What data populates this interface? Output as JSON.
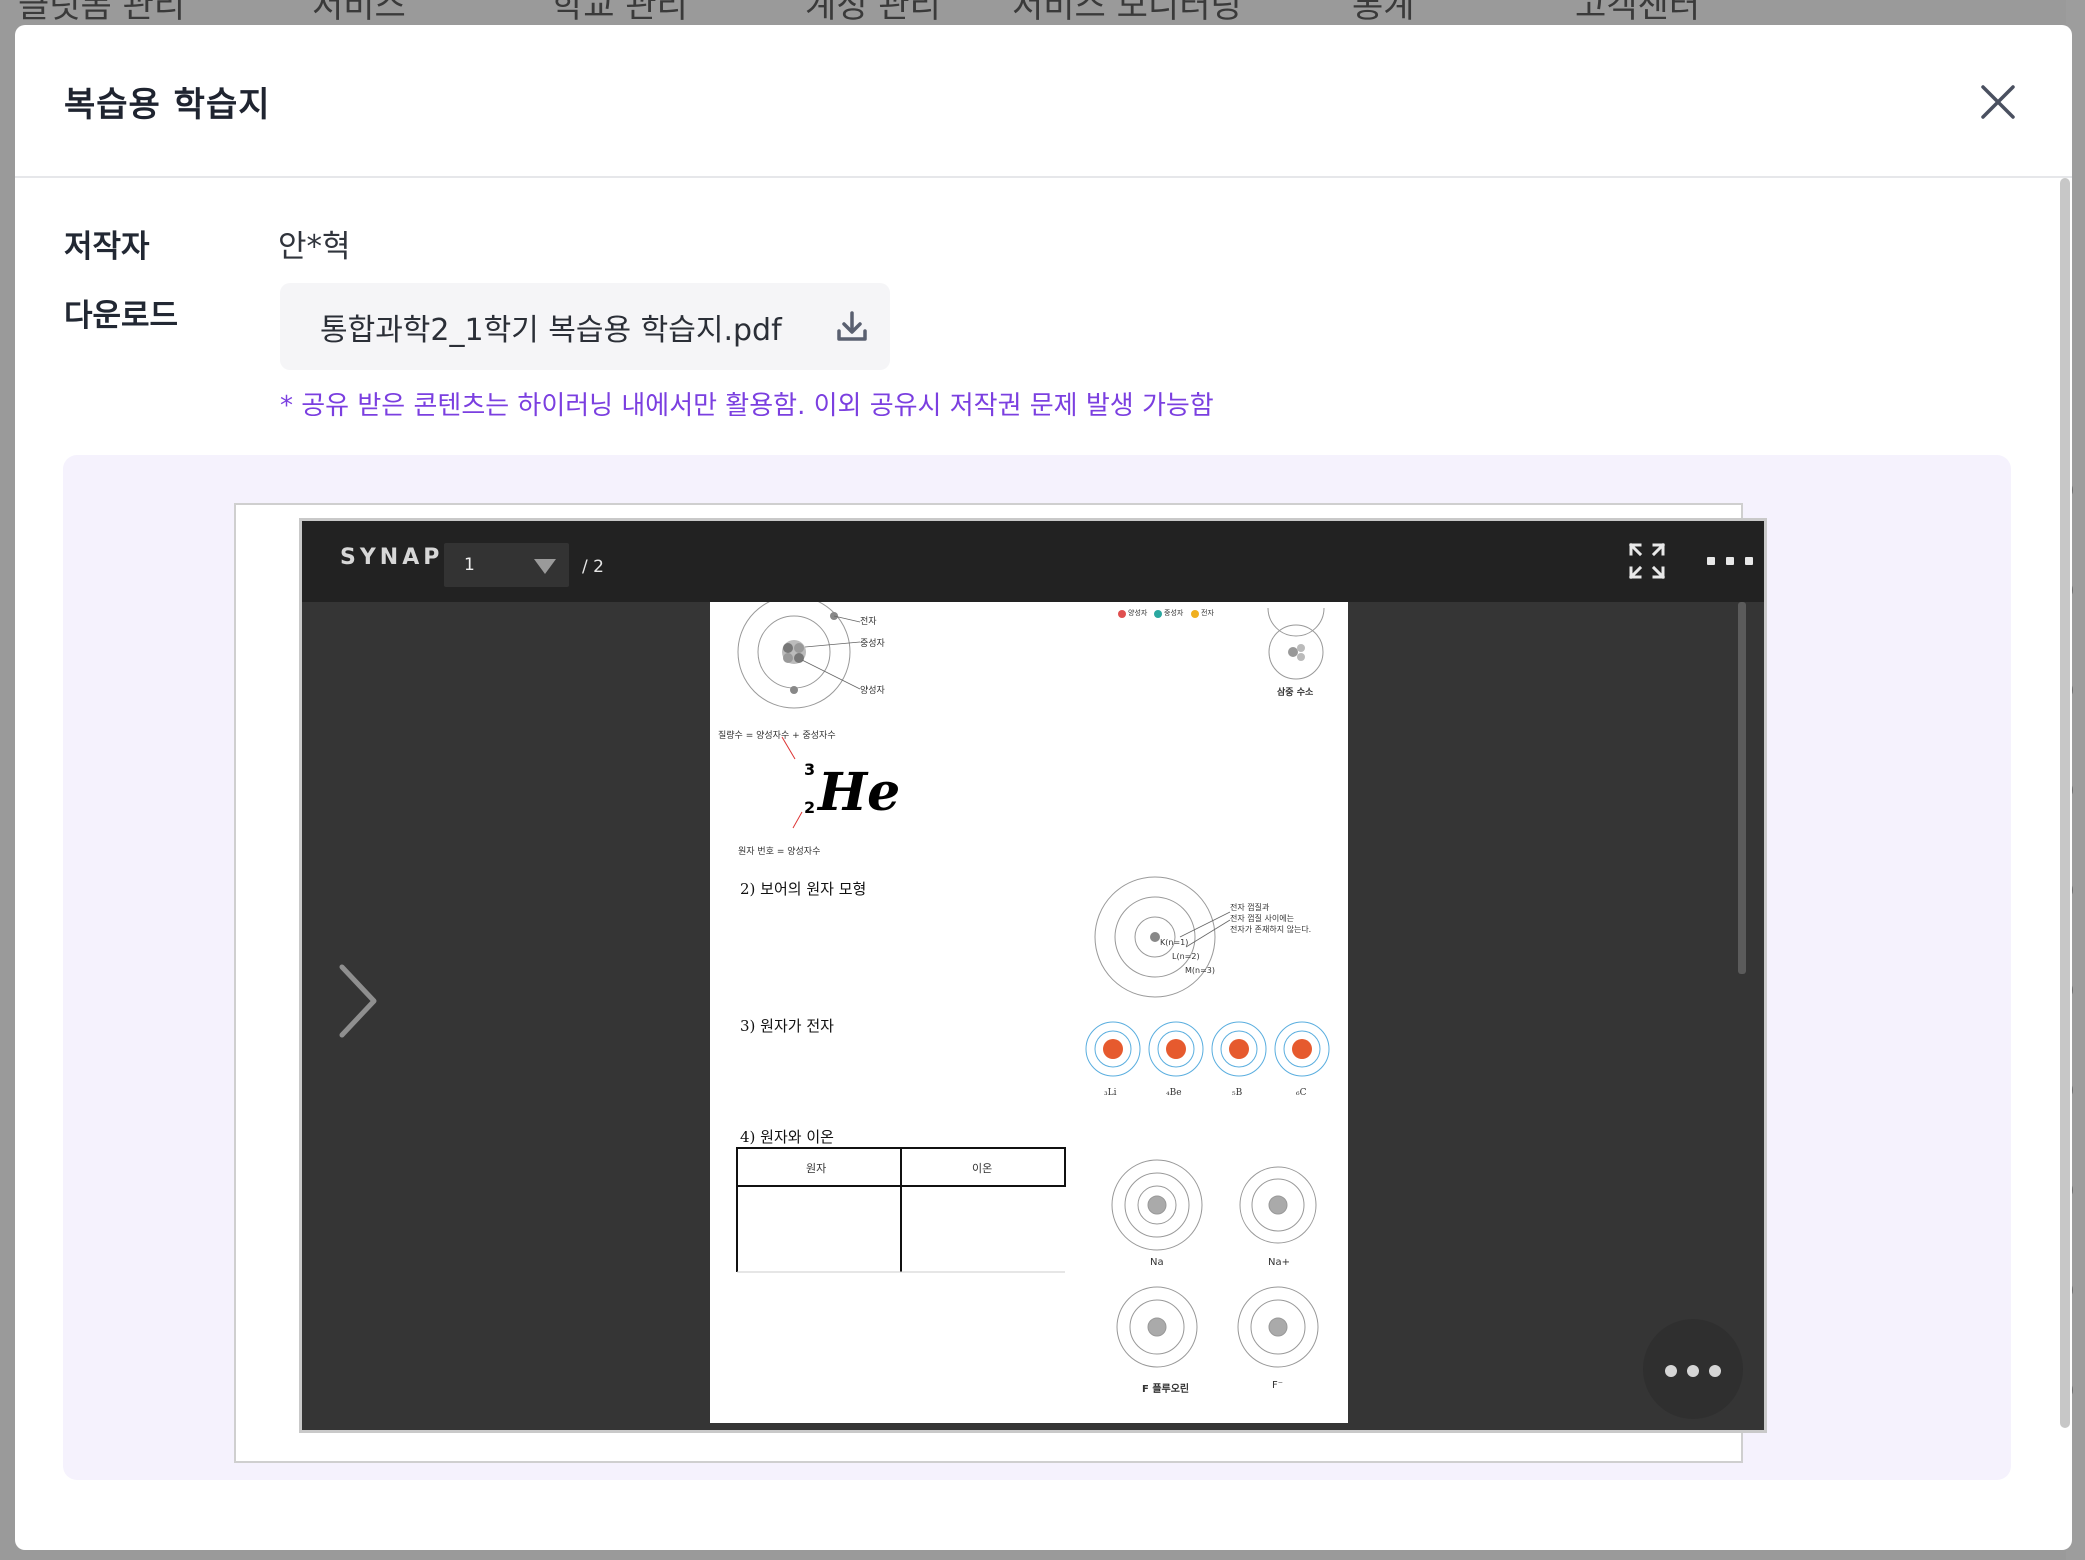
{
  "modal": {
    "title": "복습용 학습지",
    "author_label": "저작자",
    "author_value": "안*혁",
    "download_label": "다운로드",
    "file_name": "통합과학2_1학기 복습용 학습지.pdf",
    "notice": "* 공유 받은 콘텐츠는 하이러닝 내에서만 활용함. 이외 공유시 저작권 문제 발생 가능함",
    "notice_color": "#7b3fe0"
  },
  "viewer": {
    "logo": "SYNAP",
    "current_page": "1",
    "total_pages": "/ 2"
  },
  "document": {
    "labels": {
      "electron": "전자",
      "neutron": "중성자",
      "proton": "양성자",
      "legend_proton": "양성자",
      "legend_neutron": "중성자",
      "legend_electron": "전자",
      "hydrogen_caption": "삼중 수소",
      "mass_formula": "질량수 = 양성자수 + 중성자수",
      "mass_number": "3",
      "atomic_number": "2",
      "element_symbol": "He",
      "atomic_formula": "원자 번호 = 양성자수",
      "q2": "2) 보어의 원자 모형",
      "shell_note_1": "전자 껍질과",
      "shell_note_2": "전자 껍질 사이에는",
      "shell_note_3": "전자가 존재하지 않는다.",
      "shell_k": "K(n=1)",
      "shell_l": "L(n=2)",
      "shell_m": "M(n=3)",
      "q3": "3) 원자가 전자",
      "li": "₃Li",
      "be": "₄Be",
      "b": "₅B",
      "c": "₆C",
      "q4": "4) 원자와 이온",
      "table_atom": "원자",
      "table_ion": "이온",
      "na": "Na",
      "na_ion": "Na+",
      "f": "F 플루오린",
      "f_ion": "F⁻"
    }
  },
  "background": {
    "nav_items": [
      "클릿폼 관리",
      "서비스",
      "학교 관리",
      "계정 관리",
      "서비스 모니터링",
      "통계",
      "고객센터"
    ]
  },
  "colors": {
    "accent": "#7b3fe0",
    "preview_bg": "#f5f2fd",
    "viewer_bg": "#353535",
    "toolbar_bg": "#222222"
  }
}
